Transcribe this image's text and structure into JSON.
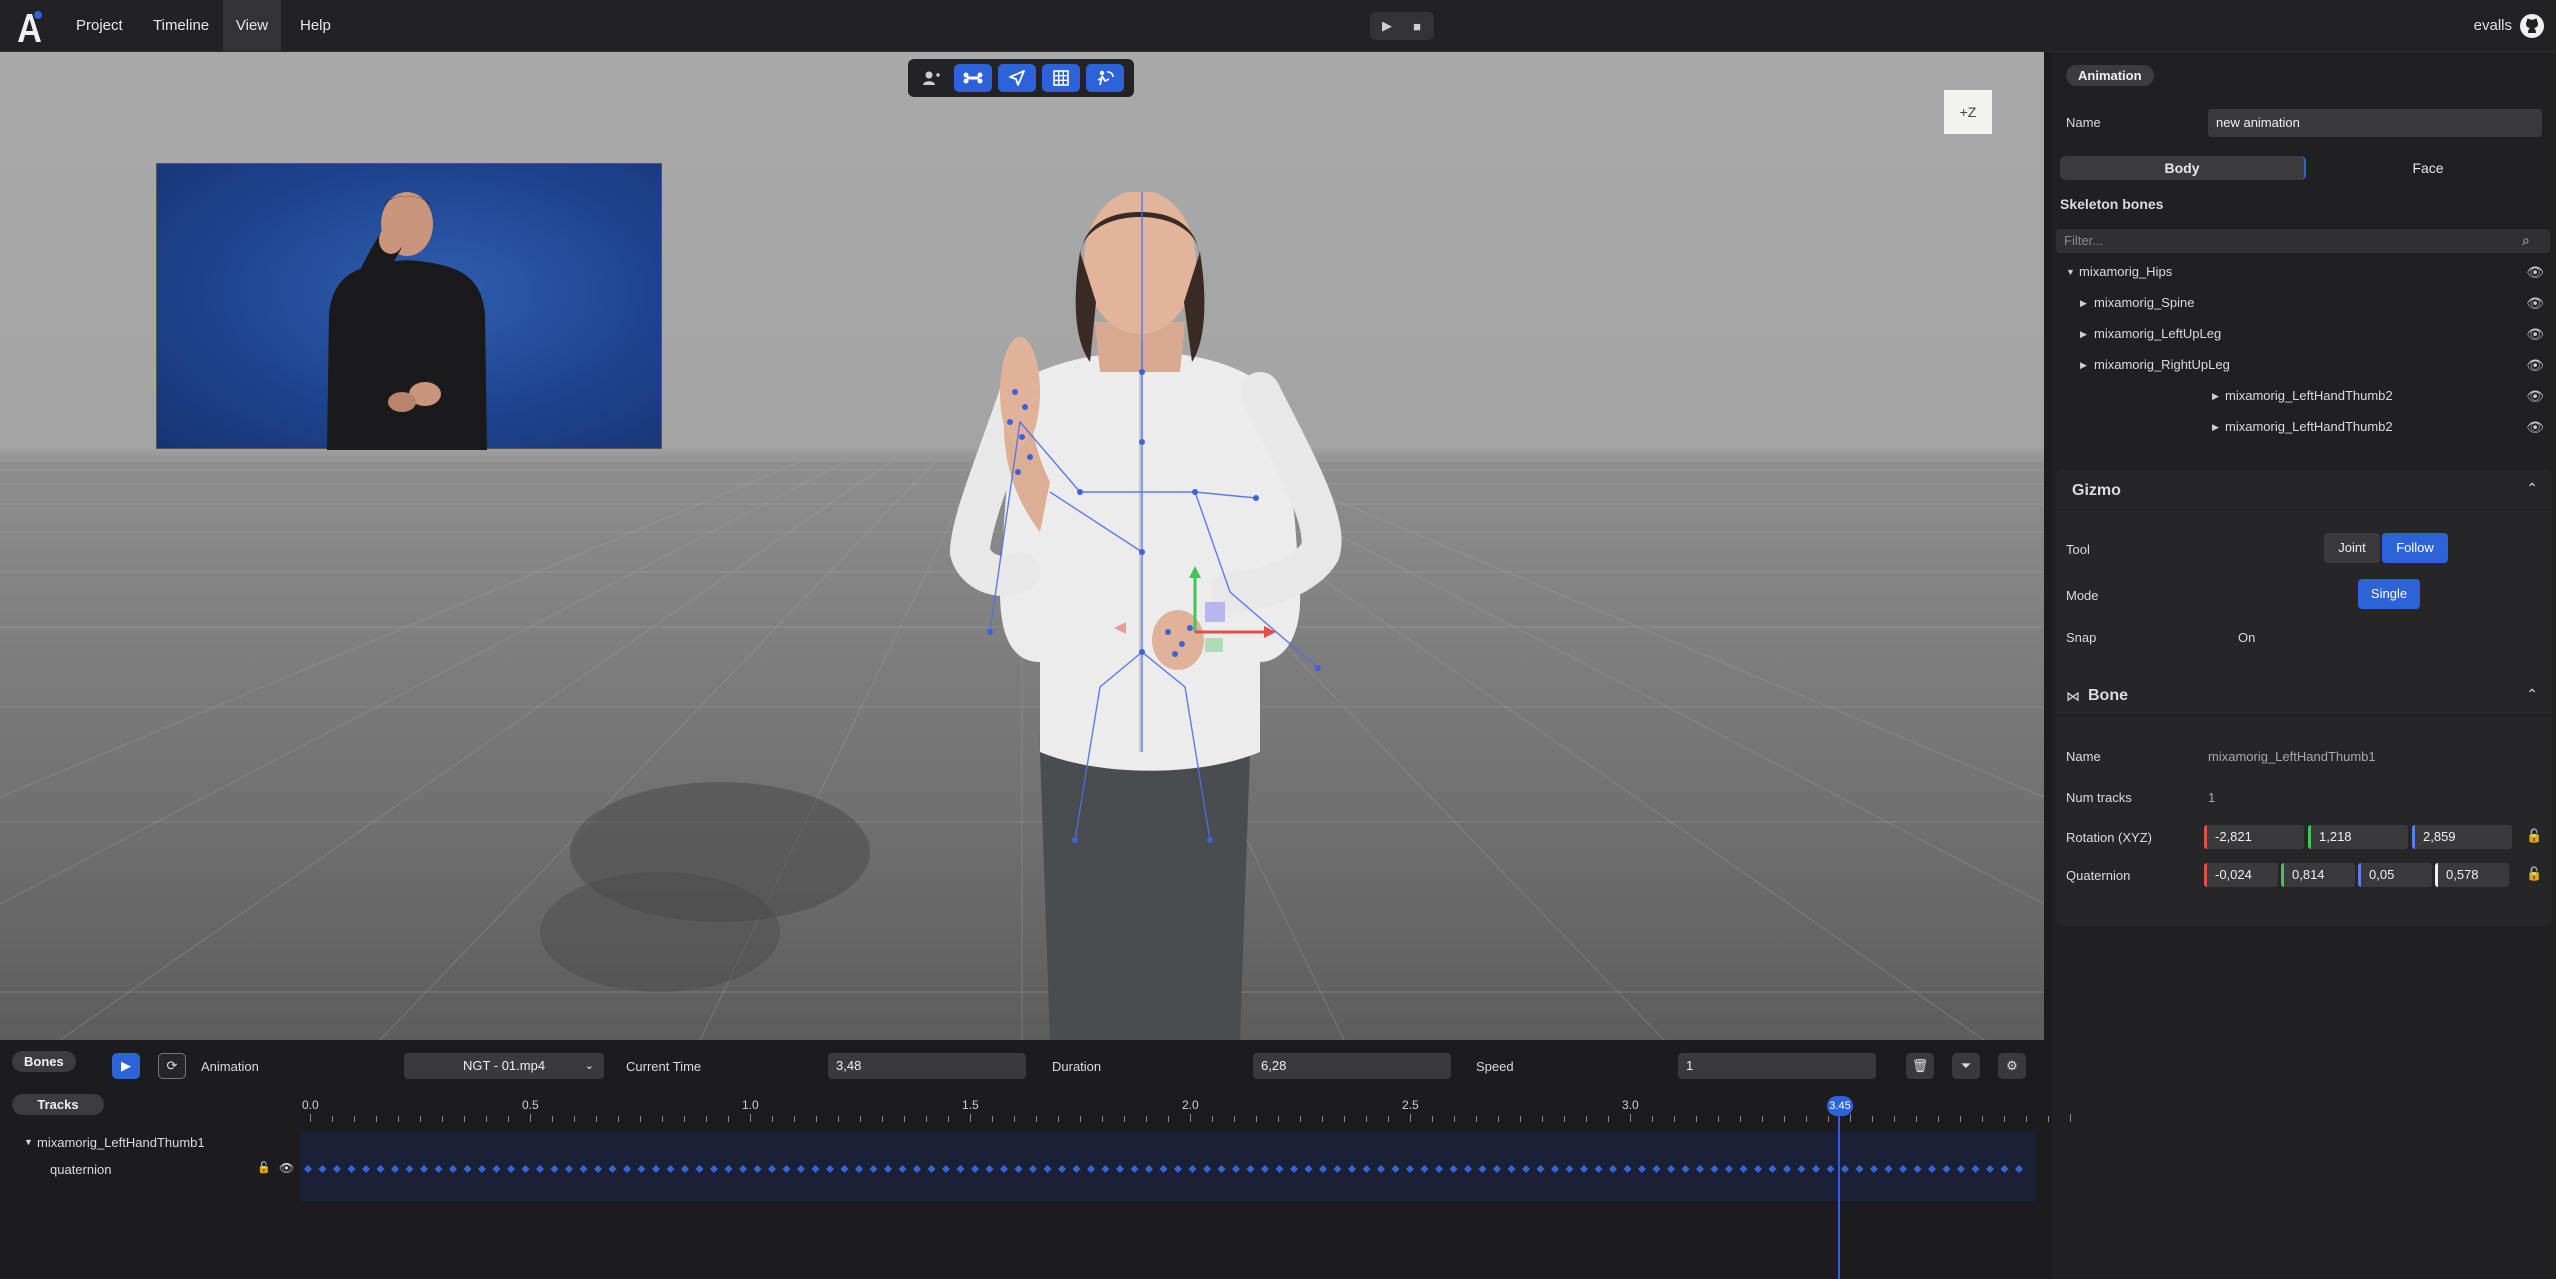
{
  "menubar": {
    "menus": [
      "Project",
      "Timeline",
      "View",
      "Help"
    ],
    "active_menu": "View",
    "user": "evalls"
  },
  "viewport": {
    "toolbar_icons": [
      "add-user-icon",
      "bone-icon",
      "send-icon",
      "grid-icon",
      "pose-icon"
    ],
    "axis_label": "+Z"
  },
  "panel": {
    "animation_badge": "Animation",
    "name_label": "Name",
    "name_value": "new animation",
    "tabs": [
      "Body",
      "Face"
    ],
    "selected_tab": "Body",
    "skeleton_title": "Skeleton bones",
    "filter_placeholder": "Filter...",
    "bones": [
      {
        "label": "mixamorig_Hips",
        "expanded": true
      },
      {
        "label": "mixamorig_Spine",
        "expanded": false
      },
      {
        "label": "mixamorig_LeftUpLeg",
        "expanded": false
      },
      {
        "label": "mixamorig_RightUpLeg",
        "expanded": false
      },
      {
        "label": "mixamorig_LeftHandThumb2",
        "expanded": false
      },
      {
        "label": "mixamorig_LeftHandThumb2",
        "expanded": false
      }
    ]
  },
  "gizmo": {
    "title": "Gizmo",
    "tool_label": "Tool",
    "tool_options": [
      "Joint",
      "Follow"
    ],
    "tool_selected": "Follow",
    "mode_label": "Mode",
    "mode_value": "Single",
    "snap_label": "Snap",
    "snap_value": "On"
  },
  "bone": {
    "title": "Bone",
    "name_label": "Name",
    "name_value": "mixamorig_LeftHandThumb1",
    "num_tracks_label": "Num tracks",
    "num_tracks_value": "1",
    "rotation_label": "Rotation (XYZ)",
    "rotation": [
      "-2,821",
      "1,218",
      "2,859"
    ],
    "quaternion_label": "Quaternion",
    "quaternion": [
      "-0,024",
      "0,814",
      "0,05",
      "0,578"
    ]
  },
  "timeline_bar": {
    "bones_button": "Bones",
    "animation_label": "Animation",
    "animation_select": "NGT - 01.mp4",
    "current_time_label": "Current Time",
    "current_time": "3,48",
    "duration_label": "Duration",
    "duration": "6,28",
    "speed_label": "Speed",
    "speed": "1"
  },
  "tracks": {
    "tracks_button": "Tracks",
    "bone_name": "mixamorig_LeftHandThumb1",
    "track_name": "quaternion",
    "ruler_labels": [
      "0.0",
      "0.5",
      "1.0",
      "1.5",
      "2.0",
      "2.5",
      "3.0"
    ],
    "playhead_label": "3.45",
    "playhead_time": 3.48,
    "duration": 6.28
  },
  "colors": {
    "accent": "#2d63d8",
    "x_axis": "#e0504a",
    "y_axis": "#46c25a",
    "z_axis": "#5b7fe8"
  }
}
